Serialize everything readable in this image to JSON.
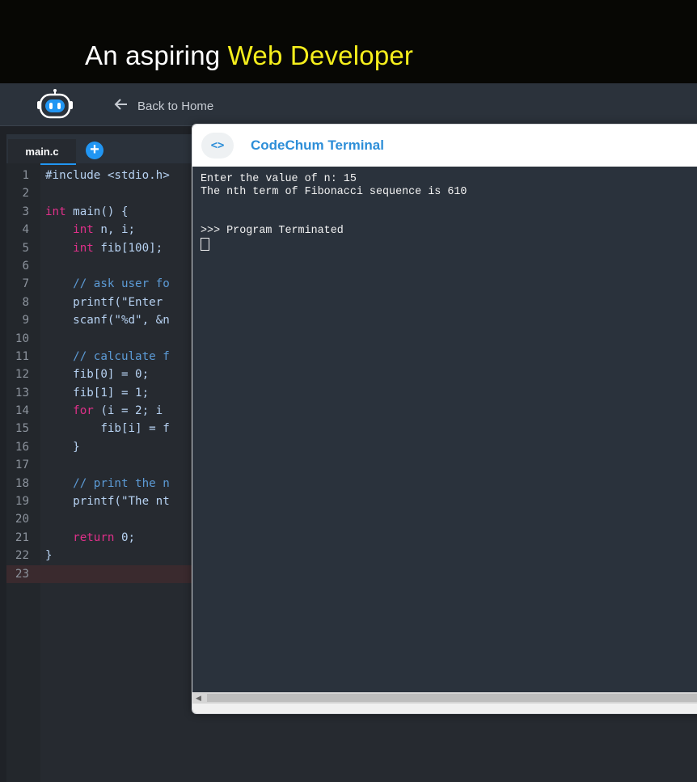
{
  "banner": {
    "headline_prefix": "An aspiring",
    "headline_accent": "Web Developer"
  },
  "header": {
    "logo_icon": "robot-logo-icon",
    "back_label": "Back to Home"
  },
  "editor": {
    "tab_label": "main.c",
    "add_tab_icon": "plus-icon",
    "lines": [
      {
        "n": "1",
        "html": "#include <stdio.h>"
      },
      {
        "n": "2",
        "html": ""
      },
      {
        "n": "3",
        "html": "int main() {"
      },
      {
        "n": "4",
        "html": "    int n, i;"
      },
      {
        "n": "5",
        "html": "    int fib[100];"
      },
      {
        "n": "6",
        "html": ""
      },
      {
        "n": "7",
        "html": "    // ask user fo"
      },
      {
        "n": "8",
        "html": "    printf(\"Enter"
      },
      {
        "n": "9",
        "html": "    scanf(\"%d\", &n"
      },
      {
        "n": "10",
        "html": ""
      },
      {
        "n": "11",
        "html": "    // calculate f"
      },
      {
        "n": "12",
        "html": "    fib[0] = 0;"
      },
      {
        "n": "13",
        "html": "    fib[1] = 1;"
      },
      {
        "n": "14",
        "html": "    for (i = 2; i"
      },
      {
        "n": "15",
        "html": "        fib[i] = f"
      },
      {
        "n": "16",
        "html": "    }"
      },
      {
        "n": "17",
        "html": ""
      },
      {
        "n": "18",
        "html": "    // print the n"
      },
      {
        "n": "19",
        "html": "    printf(\"The nt"
      },
      {
        "n": "20",
        "html": ""
      },
      {
        "n": "21",
        "html": "    return 0;"
      },
      {
        "n": "22",
        "html": "}"
      },
      {
        "n": "23",
        "html": ""
      }
    ]
  },
  "terminal": {
    "icon": "code-brackets-icon",
    "icon_text": "<>",
    "title": "CodeChum Terminal",
    "output_line1": "Enter the value of n: 15",
    "output_line2": "The nth term of Fibonacci sequence is 610",
    "output_line3": ">>> Program Terminated"
  }
}
